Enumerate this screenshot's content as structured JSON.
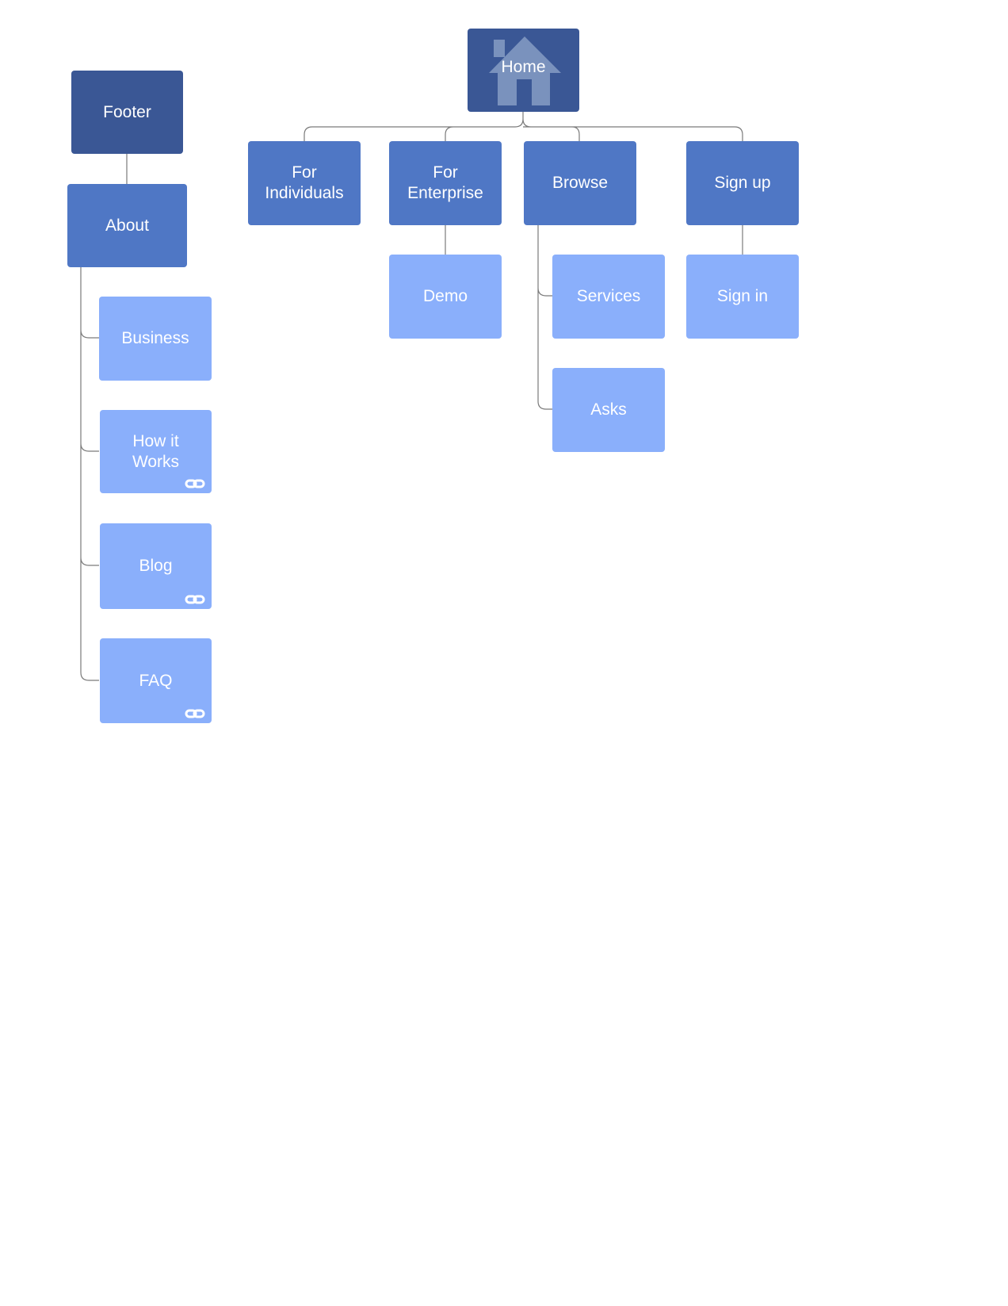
{
  "colors": {
    "root": "#3a5795",
    "level1": "#4f77c5",
    "level2": "#8aaffb",
    "connector": "#7a7a7a"
  },
  "nodes": {
    "home": {
      "label": "Home",
      "icon": "house-icon"
    },
    "footer": {
      "label": "Footer"
    },
    "about": {
      "label": "About"
    },
    "for_individuals": {
      "label": "For\nIndividuals"
    },
    "for_enterprise": {
      "label": "For\nEnterprise"
    },
    "browse": {
      "label": "Browse"
    },
    "sign_up": {
      "label": "Sign up"
    },
    "demo": {
      "label": "Demo"
    },
    "services": {
      "label": "Services"
    },
    "sign_in": {
      "label": "Sign in"
    },
    "asks": {
      "label": "Asks"
    },
    "business": {
      "label": "Business"
    },
    "how_it_works": {
      "label": "How it\nWorks",
      "icon": "link-icon"
    },
    "blog": {
      "label": "Blog",
      "icon": "link-icon"
    },
    "faq": {
      "label": "FAQ",
      "icon": "link-icon"
    }
  }
}
